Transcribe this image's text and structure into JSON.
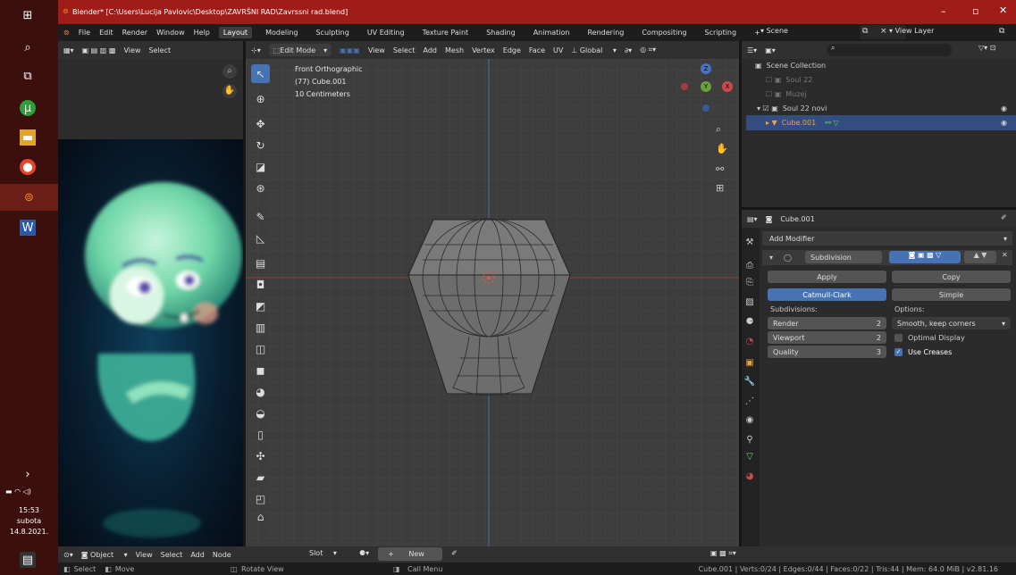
{
  "title_bar": {
    "title": "Blender* [C:\\Users\\Lucija Pavlovic\\Desktop\\ZAVRŠNI RAD\\Zavrssni rad.blend]"
  },
  "menu": [
    "File",
    "Edit",
    "Render",
    "Window",
    "Help"
  ],
  "workspaces": [
    "Layout",
    "Modeling",
    "Sculpting",
    "UV Editing",
    "Texture Paint",
    "Shading",
    "Animation",
    "Rendering",
    "Compositing",
    "Scripting"
  ],
  "workspace_add": "+",
  "scene": {
    "label": "Scene",
    "view_layer": "View Layer"
  },
  "image_editor": {
    "view": "View",
    "select": "Select"
  },
  "viewport": {
    "mode": "Edit Mode",
    "menus": [
      "View",
      "Select",
      "Add",
      "Mesh",
      "Vertex",
      "Edge",
      "Face",
      "UV"
    ],
    "orientation": "Global",
    "overlay_lines": [
      "Front Orthographic",
      "(77) Cube.001",
      "10 Centimeters"
    ],
    "gizmo_labels": {
      "z": "Z",
      "y": "Y",
      "x": "X"
    }
  },
  "outliner": {
    "items": [
      {
        "label": "Scene Collection"
      },
      {
        "label": "Soul 22"
      },
      {
        "label": "Muzej"
      },
      {
        "label": "Soul 22 novi"
      },
      {
        "label": "Cube.001"
      }
    ]
  },
  "properties": {
    "object_name": "Cube.001",
    "add_modifier": "Add Modifier",
    "modifier_name": "Subdivision",
    "apply": "Apply",
    "copy": "Copy",
    "catmull": "Catmull-Clark",
    "simple": "Simple",
    "subdivisions_label": "Subdivisions:",
    "options_label": "Options:",
    "render_label": "Render",
    "render_value": "2",
    "viewport_label": "Viewport",
    "viewport_value": "2",
    "quality_label": "Quality",
    "quality_value": "3",
    "uv_smooth": "Smooth, keep corners",
    "optimal_display": "Optimal Display",
    "use_creases": "Use Creases"
  },
  "timeline": {
    "object_mode": "Object",
    "menus": [
      "View",
      "Select",
      "Add",
      "Node"
    ],
    "slot": "Slot",
    "new": "New"
  },
  "status": {
    "select": "Select",
    "move": "Move",
    "rotate": "Rotate View",
    "call_menu": "Call Menu",
    "stats": "Cube.001 | Verts:0/24 | Edges:0/44 | Faces:0/22 | Tris:44 | Mem: 64.0 MiB | v2.81.16"
  },
  "taskbar": {
    "time": "15:53",
    "day": "subota",
    "date": "14.8.2021."
  },
  "colors": {
    "title": "#a01c18",
    "selection": "#4772b3",
    "x_axis": "#b33a3a",
    "z_axis": "#4a72c0"
  }
}
